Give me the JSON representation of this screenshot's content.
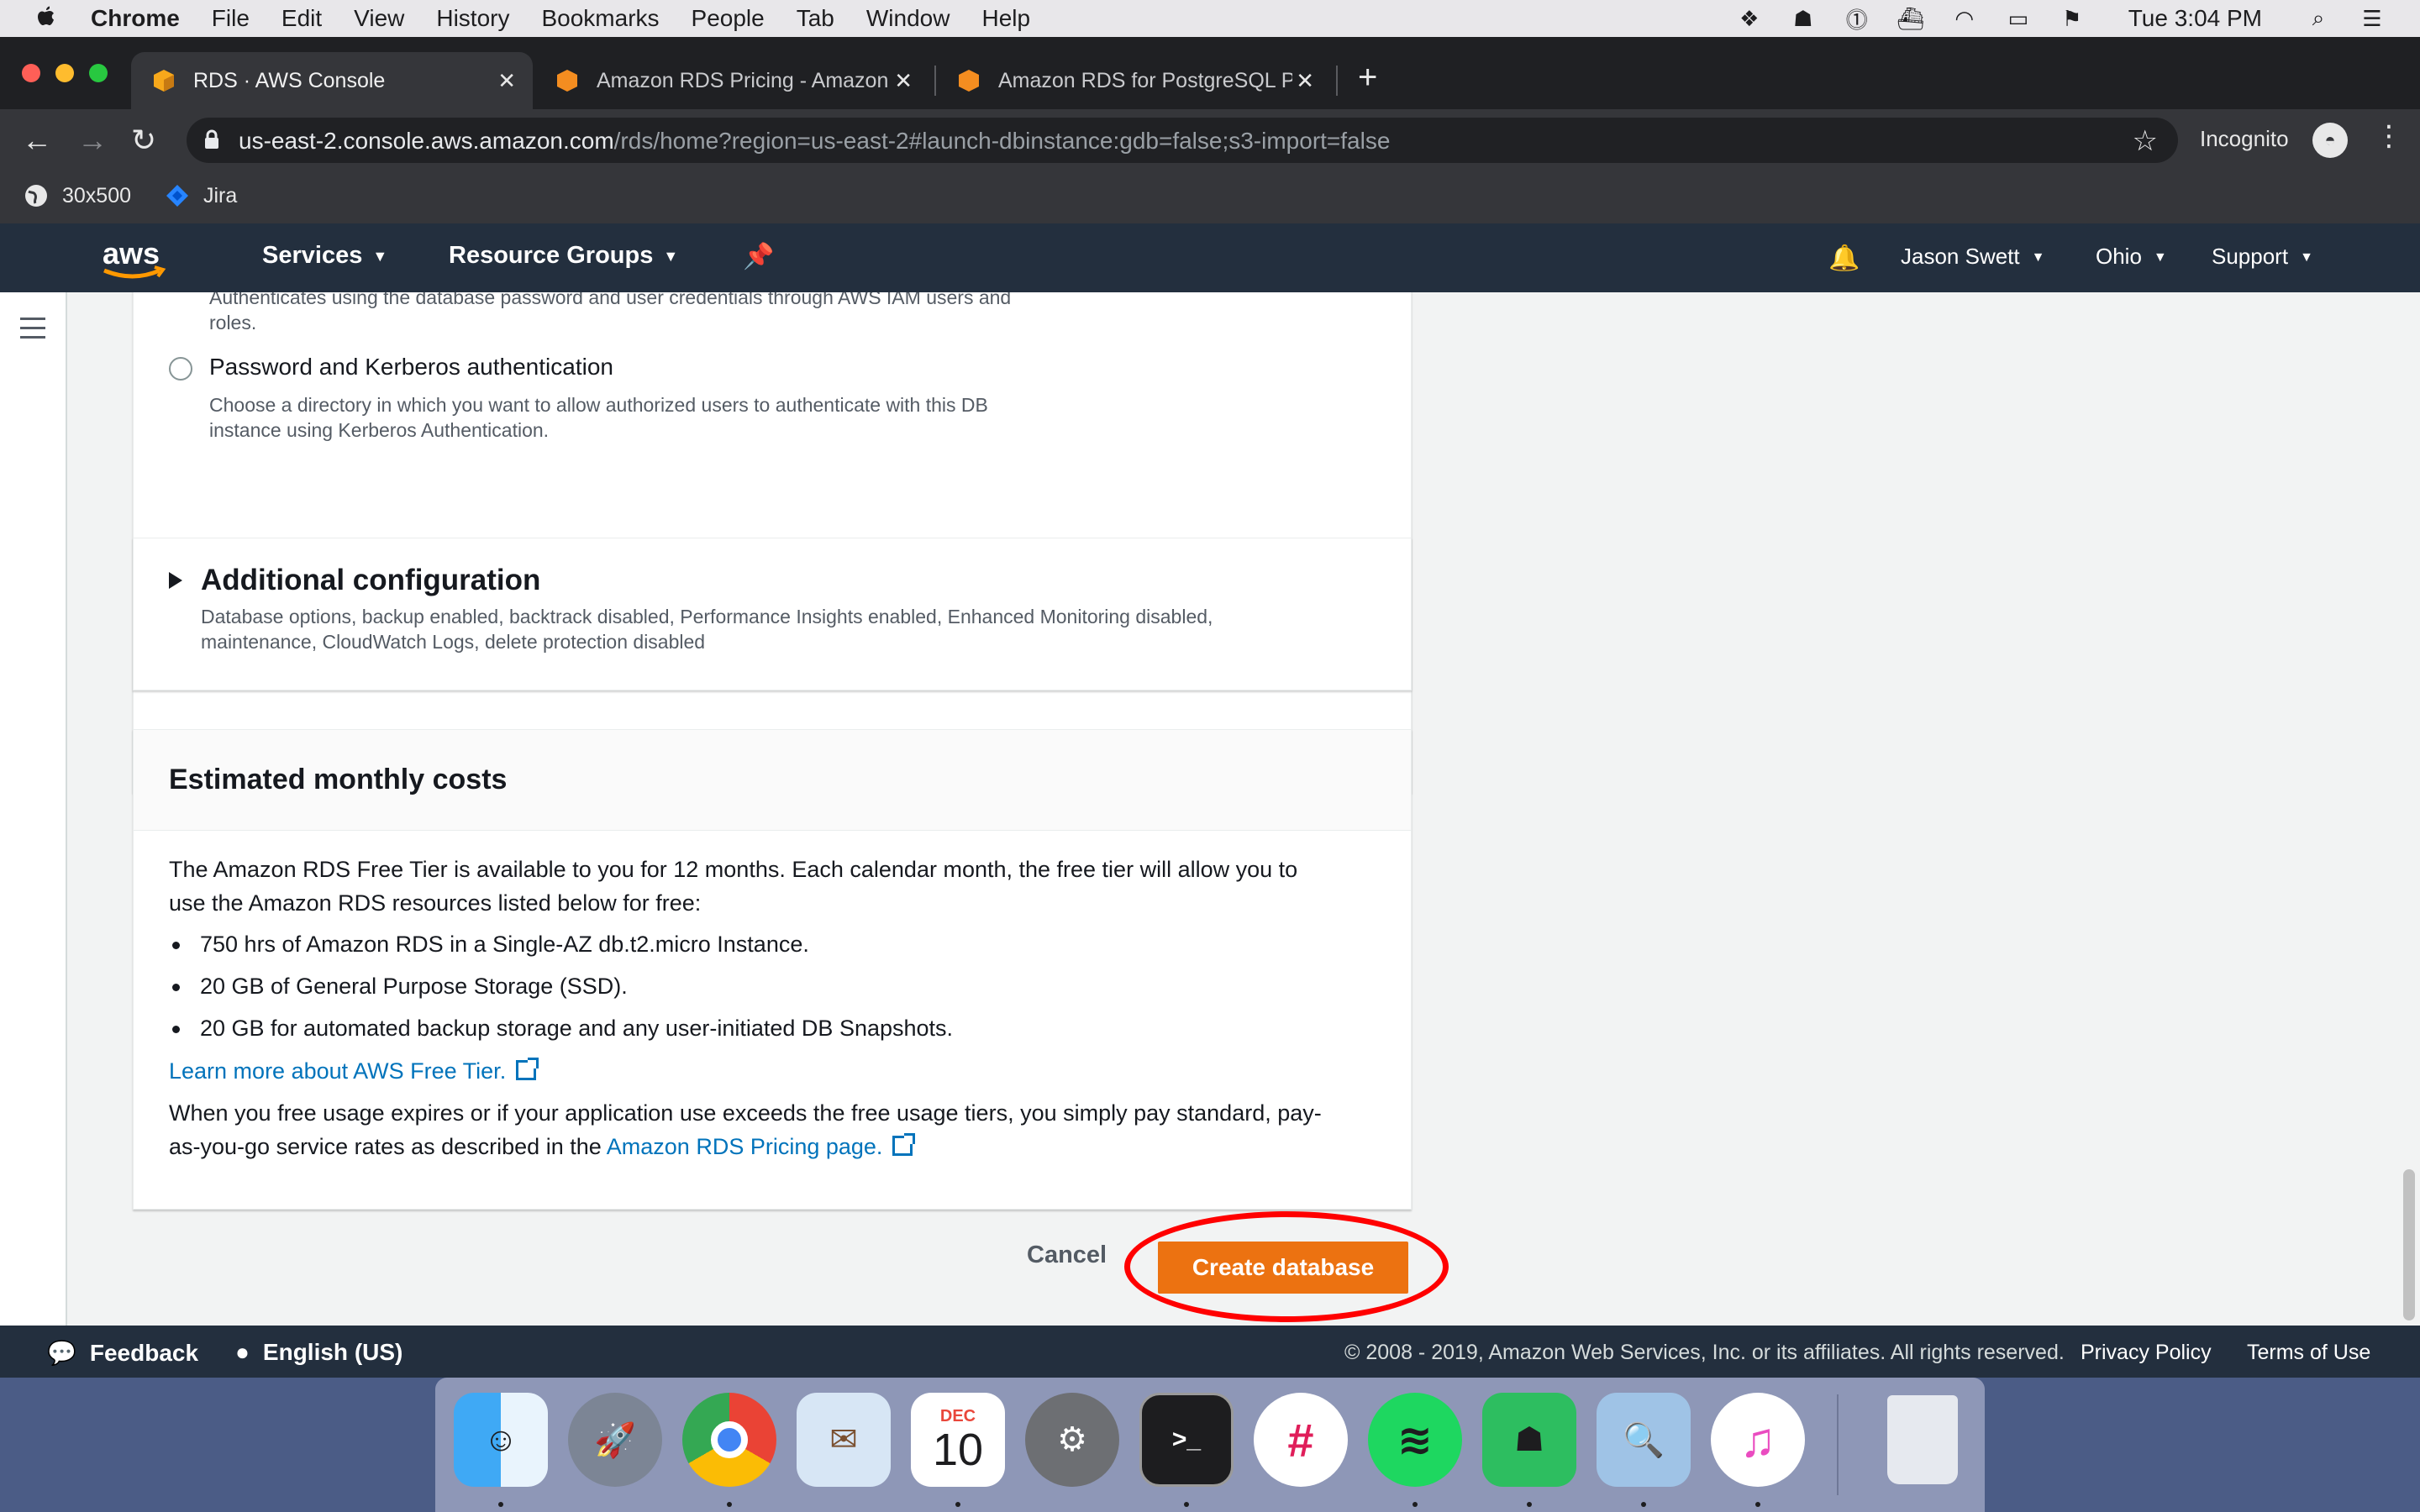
{
  "menubar": {
    "app": "Chrome",
    "items": [
      "File",
      "Edit",
      "View",
      "History",
      "Bookmarks",
      "People",
      "Tab",
      "Window",
      "Help"
    ],
    "clock": "Tue 3:04 PM",
    "status_icons": [
      "dropbox-icon",
      "evernote-icon",
      "onepassword-icon",
      "docker-icon",
      "wifi-icon",
      "battery-icon",
      "us-flag-icon",
      "spotlight-icon",
      "notification-center-icon"
    ]
  },
  "tabs": [
    {
      "title": "RDS · AWS Console",
      "active": true
    },
    {
      "title": "Amazon RDS Pricing - Amazon",
      "active": false
    },
    {
      "title": "Amazon RDS for PostgreSQL P",
      "active": false
    }
  ],
  "toolbar": {
    "url_host": "us-east-2.console.aws.amazon.com",
    "url_path": "/rds/home?region=us-east-2#launch-dbinstance:gdb=false;s3-import=false",
    "incognito_label": "Incognito"
  },
  "bookmarks": [
    {
      "label": "30x500"
    },
    {
      "label": "Jira"
    }
  ],
  "aws_header": {
    "logo_text": "aws",
    "services": "Services",
    "resource_groups": "Resource Groups",
    "user": "Jason Swett",
    "region": "Ohio",
    "support": "Support"
  },
  "auth_panel": {
    "iam_desc_line1": "Authenticates using the database password and user credentials through AWS IAM users and",
    "iam_desc_line2": "roles.",
    "kerberos_label": "Password and Kerberos authentication",
    "kerberos_desc_line1": "Choose a directory in which you want to allow authorized users to authenticate with this DB",
    "kerberos_desc_line2": "instance using Kerberos Authentication."
  },
  "additional_config": {
    "title": "Additional configuration",
    "desc_line1": "Database options, backup enabled, backtrack disabled, Performance Insights enabled, Enhanced Monitoring disabled,",
    "desc_line2": "maintenance, CloudWatch Logs, delete protection disabled"
  },
  "costs": {
    "title": "Estimated monthly costs",
    "intro_line1": "The Amazon RDS Free Tier is available to you for 12 months. Each calendar month, the free tier will allow you to",
    "intro_line2": "use the Amazon RDS resources listed below for free:",
    "bullets": [
      "750 hrs of Amazon RDS in a Single-AZ db.t2.micro Instance.",
      "20 GB of General Purpose Storage (SSD).",
      "20 GB for automated backup storage and any user-initiated DB Snapshots."
    ],
    "learn_more": "Learn more about AWS Free Tier.",
    "outro_line1": "When you free usage expires or if your application use exceeds the free usage tiers, you simply pay standard, pay-",
    "outro_line2_prefix": "as-you-go service rates as described in the ",
    "pricing_link": "Amazon RDS Pricing page."
  },
  "actions": {
    "cancel": "Cancel",
    "create": "Create database"
  },
  "footer": {
    "feedback": "Feedback",
    "language": "English (US)",
    "copyright": "© 2008 - 2019, Amazon Web Services, Inc. or its affiliates. All rights reserved.",
    "privacy": "Privacy Policy",
    "terms": "Terms of Use"
  },
  "dock": {
    "calendar_month": "DEC",
    "calendar_day": "10",
    "apps": [
      "finder",
      "launchpad",
      "chrome",
      "mail",
      "calendar",
      "system-preferences",
      "terminal",
      "slack",
      "spotify",
      "evernote",
      "preview",
      "itunes",
      "trash"
    ]
  },
  "colors": {
    "aws_nav": "#232f3e",
    "aws_orange": "#ec7211",
    "link": "#0073bb",
    "highlight_circle": "#ff0000"
  }
}
